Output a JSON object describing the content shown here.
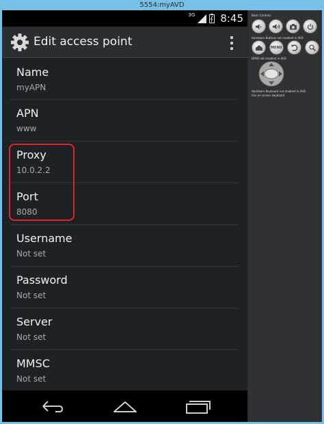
{
  "window": {
    "title": "5554:myAVD"
  },
  "status_bar": {
    "network": "3G",
    "time": "8:45"
  },
  "action_bar": {
    "title": "Edit access point"
  },
  "preferences": [
    {
      "title": "Name",
      "summary": "myAPN"
    },
    {
      "title": "APN",
      "summary": "www"
    },
    {
      "title": "Proxy",
      "summary": "10.0.2.2"
    },
    {
      "title": "Port",
      "summary": "8080"
    },
    {
      "title": "Username",
      "summary": "Not set"
    },
    {
      "title": "Password",
      "summary": "Not set"
    },
    {
      "title": "Server",
      "summary": "Not set"
    },
    {
      "title": "MMSC",
      "summary": "Not set"
    }
  ],
  "controls": {
    "basic_label": "Basic Controls",
    "hardware_label": "Hardware Buttons not enabled in AVD",
    "menu_label": "MENU",
    "dpad_label": "DPAD not enabled in AVD",
    "keyboard_label_1": "Hardware Keyboard not enabled in AVD",
    "keyboard_label_2": "Use on screen keyboard"
  },
  "colors": {
    "highlight": "#e0232e",
    "frame": "#77c0e8"
  }
}
